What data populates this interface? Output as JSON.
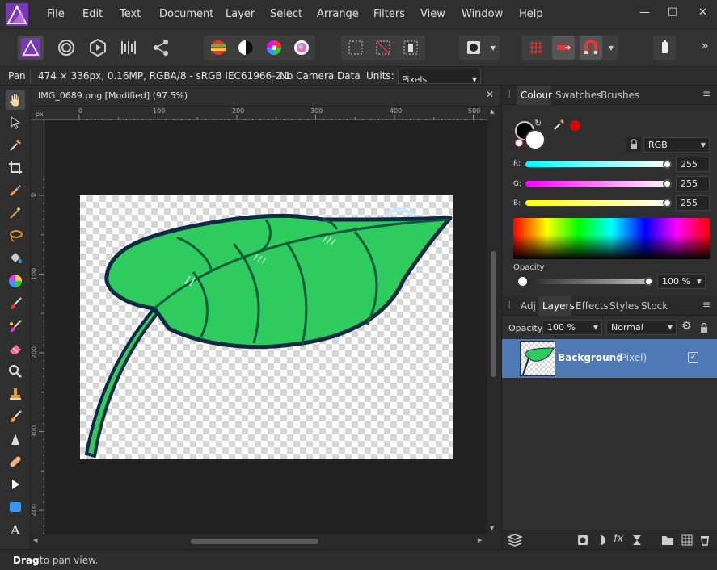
{
  "menu": [
    "File",
    "Edit",
    "Text",
    "Document",
    "Layer",
    "Select",
    "Arrange",
    "Filters",
    "View",
    "Window",
    "Help"
  ],
  "window_controls": {
    "minimize": "—",
    "maximize": "□",
    "close": "✕"
  },
  "toolbar": {
    "overflow": "»"
  },
  "context": {
    "tool": "Pan",
    "doc_info": "474 × 336px, 0.16MP, RGBA/8 - sRGB IEC61966-2.1",
    "camera": "No Camera Data",
    "units_label": "Units:",
    "units_value": "Pixels"
  },
  "document": {
    "tab_title": "IMG_0689.png [Modified] (97.5%)",
    "close": "✕",
    "ruler_unit": "px",
    "ruler_x": [
      "0",
      "100",
      "200",
      "300",
      "400",
      "500"
    ],
    "ruler_y": [
      "0",
      "100",
      "200",
      "300",
      "400"
    ]
  },
  "status": {
    "bold": "Drag",
    "rest": "to pan view."
  },
  "colour_panel": {
    "tabs": [
      "Colour",
      "Swatches",
      "Brushes"
    ],
    "model": "RGB",
    "r_label": "R:",
    "r": "255",
    "g_label": "G:",
    "g": "255",
    "b_label": "B:",
    "b": "255",
    "opacity_label": "Opacity",
    "opacity": "100 %",
    "colors": {
      "primary": "#000000",
      "secondary": "#ffffff",
      "red_dot": "#e00000"
    }
  },
  "layers_panel": {
    "tabs": [
      "Adj",
      "Layers",
      "Effects",
      "Styles",
      "Stock"
    ],
    "opacity_label": "Opacity:",
    "opacity": "100 %",
    "blend": "Normal",
    "layer_name": "Background",
    "layer_type": "(Pixel)",
    "visible_check": "✓"
  },
  "accent": "#4f79b5",
  "leaf": {
    "fill": "#2ecc5e",
    "outline": "#0e2a45"
  }
}
